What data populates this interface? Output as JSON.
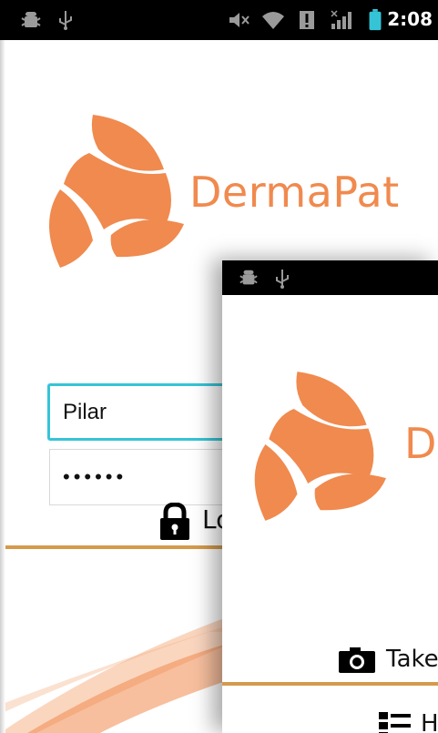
{
  "status_bar": {
    "time": "2:08",
    "icons": [
      "android-debug-icon",
      "usb-icon",
      "mute-icon",
      "wifi-icon",
      "alert-icon",
      "signal-icon",
      "battery-icon"
    ]
  },
  "app": {
    "brand_name": "DermaPat",
    "brand_color": "#f08a4e",
    "accent_color": "#35c4d6",
    "divider_color": "#d59a4c"
  },
  "login": {
    "username_value": "Pilar",
    "password_value": "••••••",
    "login_label_visible": "Lo"
  },
  "overlay_screen": {
    "brand_name_visible": "D",
    "take_label_visible": "Take",
    "help_label_visible": "H"
  }
}
